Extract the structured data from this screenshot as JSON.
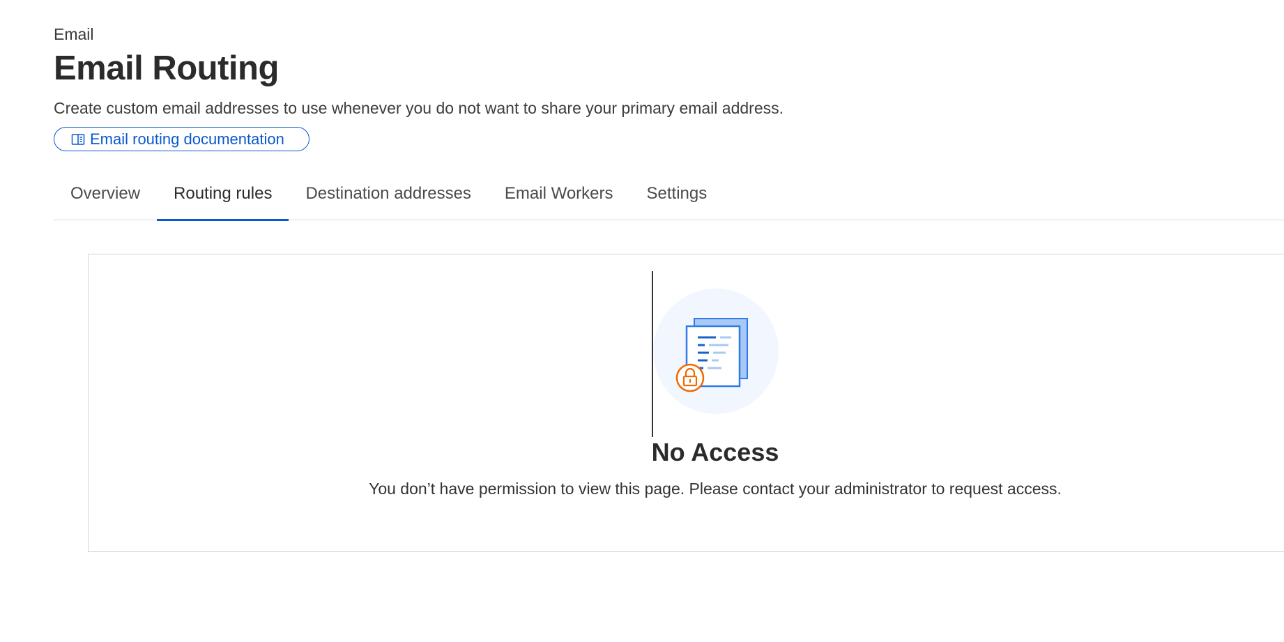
{
  "header": {
    "breadcrumb": "Email",
    "title": "Email Routing",
    "description": "Create custom email addresses to use whenever you do not want to share your primary email address.",
    "doc_link_label": "Email routing documentation",
    "doc_link_icon": "book-icon"
  },
  "tabs": [
    {
      "label": "Overview",
      "active": false
    },
    {
      "label": "Routing rules",
      "active": true
    },
    {
      "label": "Destination addresses",
      "active": false
    },
    {
      "label": "Email Workers",
      "active": false
    },
    {
      "label": "Settings",
      "active": false
    }
  ],
  "empty_state": {
    "illustration": "locked-documents-icon",
    "title": "No Access",
    "message": "You don’t have permission to view this page. Please contact your administrator to request access."
  },
  "colors": {
    "accent": "#0b57d0",
    "lock": "#f06a00",
    "illustration_bg": "#f2f7ff"
  }
}
